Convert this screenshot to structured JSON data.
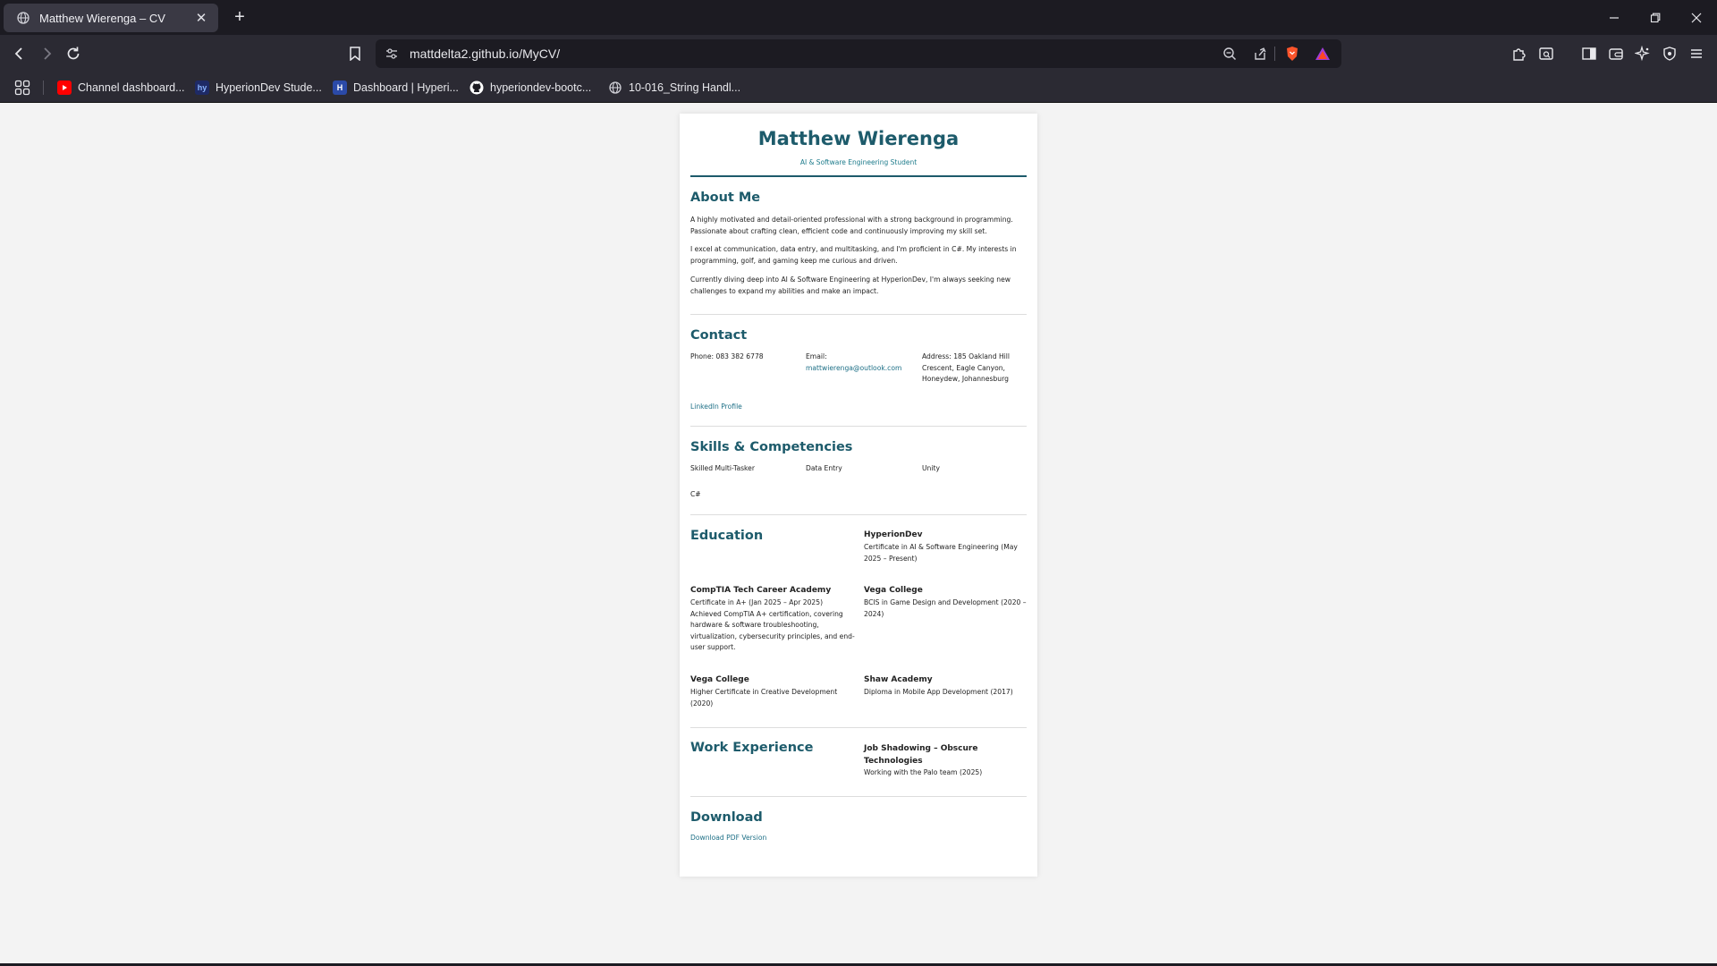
{
  "browser": {
    "tab_title": "Matthew Wierenga – CV",
    "url": "mattdelta2.github.io/MyCV/",
    "bookmarks": [
      {
        "label": "Channel dashboard...",
        "icon": "youtube-icon",
        "color": "#ff0000"
      },
      {
        "label": "HyperionDev Stude...",
        "icon": "hyperiondev-icon",
        "color": "#1e2a66"
      },
      {
        "label": "Dashboard | Hyperi...",
        "icon": "hyperion-h-icon",
        "color": "#2b4aa8"
      },
      {
        "label": "hyperiondev-bootc...",
        "icon": "github-icon",
        "color": "#ffffff"
      },
      {
        "label": "10-016_String Handl...",
        "icon": "globe-icon",
        "color": "#cfcfd6"
      }
    ]
  },
  "cv": {
    "name": "Matthew Wierenga",
    "subtitle": "AI & Software Engineering Student",
    "about": {
      "heading": "About Me",
      "paragraphs": [
        "A highly motivated and detail-oriented professional with a strong background in programming. Passionate about crafting clean, efficient code and continuously improving my skill set.",
        "I excel at communication, data entry, and multitasking, and I'm proficient in C#. My interests in programming, golf, and gaming keep me curious and driven.",
        "Currently diving deep into AI & Software Engineering at HyperionDev, I'm always seeking new challenges to expand my abilities and make an impact."
      ]
    },
    "contact": {
      "heading": "Contact",
      "phone": "Phone: 083 382 6778",
      "email_label": "Email:",
      "email": "mattwierenga@outlook.com",
      "address": "Address: 185 Oakland Hill Crescent, Eagle Canyon, Honeydew, Johannesburg",
      "linkedin": "LinkedIn Profile"
    },
    "skills": {
      "heading": "Skills & Competencies",
      "items": [
        "Skilled Multi-Tasker",
        "Data Entry",
        "Unity",
        "C#"
      ]
    },
    "education": {
      "heading": "Education",
      "entries": [
        {
          "school": "HyperionDev",
          "detail": "Certificate in AI & Software Engineering (May 2025 – Present)"
        },
        {
          "school": "CompTIA Tech Career Academy",
          "detail": "Certificate in A+ (Jan 2025 – Apr 2025) Achieved CompTIA A+ certification, covering hardware & software troubleshooting, virtualization, cybersecurity principles, and end-user support."
        },
        {
          "school": "Vega College",
          "detail": "BCIS in Game Design and Development (2020 – 2024)"
        },
        {
          "school": "Vega College",
          "detail": "Higher Certificate in Creative Development (2020)"
        },
        {
          "school": "Shaw Academy",
          "detail": "Diploma in Mobile App Development (2017)"
        }
      ]
    },
    "work": {
      "heading": "Work Experience",
      "title": "Job Shadowing – Obscure Technologies",
      "detail": "Working with the Palo team (2025)"
    },
    "download": {
      "heading": "Download",
      "link": "Download PDF Version"
    }
  }
}
